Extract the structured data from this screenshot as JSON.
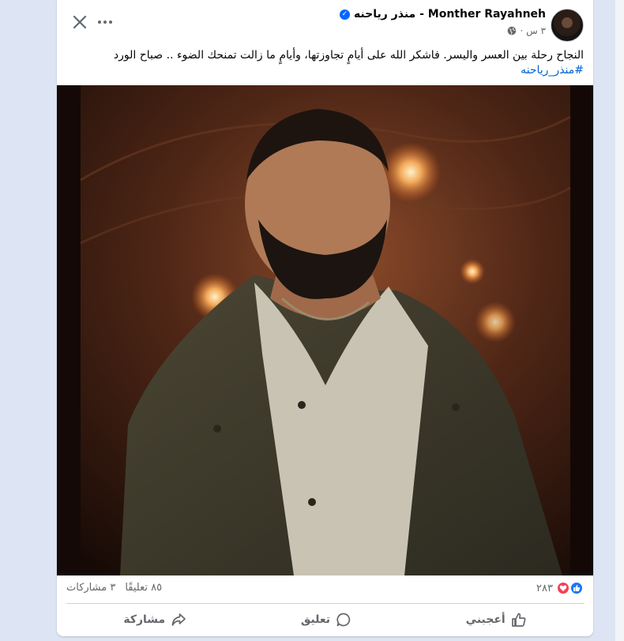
{
  "post": {
    "author": "Monther Rayahneh - منذر رياحنه",
    "time": "٣ س ·",
    "text": "النجاح رحلة بين العسر واليسر. فاشكر الله على أيامٍ تجاوزتها، وأيامٍ ما زالت تمنحك الضوء .. صباح  الورد",
    "hashtag": "#منذر_رياحنه"
  },
  "counts": {
    "reactions": "٢٨٣",
    "comments": "٨٥ تعليقًا",
    "shares": "٣ مشاركات"
  },
  "actions": {
    "like": "أعجبني",
    "comment": "تعليق",
    "share": "مشاركة"
  },
  "colors": {
    "accent": "#0866ff",
    "link": "#0064d1",
    "secondary_text": "#65676b",
    "like_blue": "#1877f2",
    "love_red": "#f33e58"
  },
  "icons": [
    "close-icon",
    "more-icon",
    "verified-icon",
    "globe-icon",
    "like-icon",
    "love-icon",
    "thumbs-up-icon",
    "comment-icon",
    "share-icon"
  ]
}
